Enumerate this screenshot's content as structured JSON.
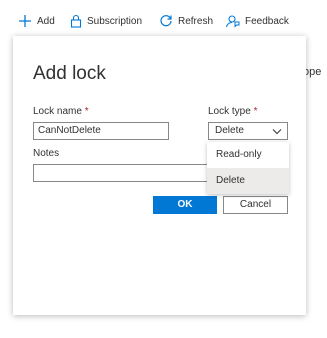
{
  "toolbar": {
    "add_label": "Add",
    "subscription_label": "Subscription",
    "refresh_label": "Refresh",
    "feedback_label": "Feedback"
  },
  "background": {
    "partial_column_text": "ope"
  },
  "dialog": {
    "title": "Add lock",
    "lock_name_label": "Lock name",
    "lock_name_value": "CanNotDelete",
    "lock_type_label": "Lock type",
    "lock_type_value": "Delete",
    "required_marker": "*",
    "notes_label": "Notes",
    "notes_value": "",
    "ok_label": "OK",
    "cancel_label": "Cancel",
    "lock_type_options": [
      "Read-only",
      "Delete"
    ],
    "selected_option": "Delete"
  },
  "colors": {
    "accent": "#0078d4",
    "required": "#a4262c",
    "selected_option_bg": "#edebe9"
  }
}
